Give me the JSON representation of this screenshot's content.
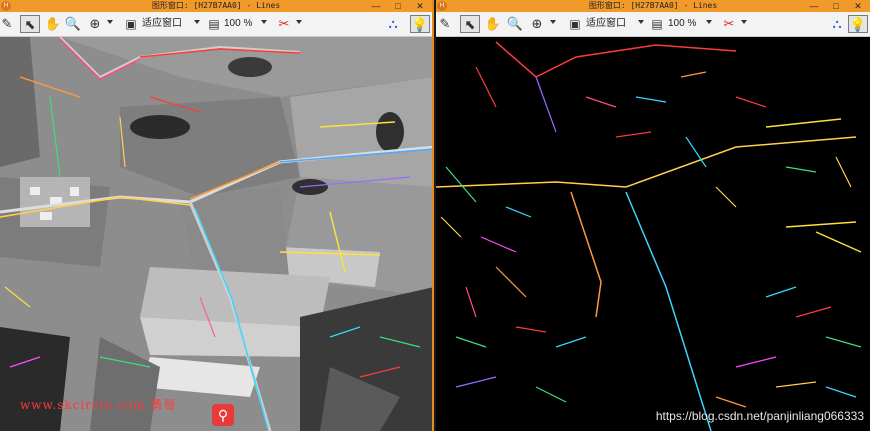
{
  "windows": {
    "left": {
      "title": "图形窗口: [H27B7AA0] - Lines",
      "zoom_fit_label": "适应窗口",
      "zoom_percent": "100 %",
      "buttons": {
        "minimize": "—",
        "maximize": "□",
        "close": "✕"
      }
    },
    "right": {
      "title": "图形窗口: [H27B7AA0] - Lines",
      "zoom_fit_label": "适应窗口",
      "zoom_percent": "100 %",
      "buttons": {
        "minimize": "—",
        "maximize": "□",
        "close": "✕"
      }
    }
  },
  "watermarks": {
    "left": "www.skcircle.com 勇哥",
    "right": "https://blog.csdn.net/panjinliang066333"
  },
  "icons": {
    "app_logo": "halcon-logo-icon",
    "pointer": "pointer-icon",
    "pan": "hand-pan-icon",
    "zoom": "magnifier-icon",
    "zoom_in": "zoom-in-icon",
    "fit": "fit-window-icon",
    "zoom_pct": "zoom-percent-icon",
    "paint": "paint-tool-icon",
    "pixel_info": "pixel-info-icon",
    "lightbulb": "lightbulb-icon"
  },
  "colors": {
    "titlebar": "#f19a2a",
    "accent_border": "#e58a1f"
  }
}
